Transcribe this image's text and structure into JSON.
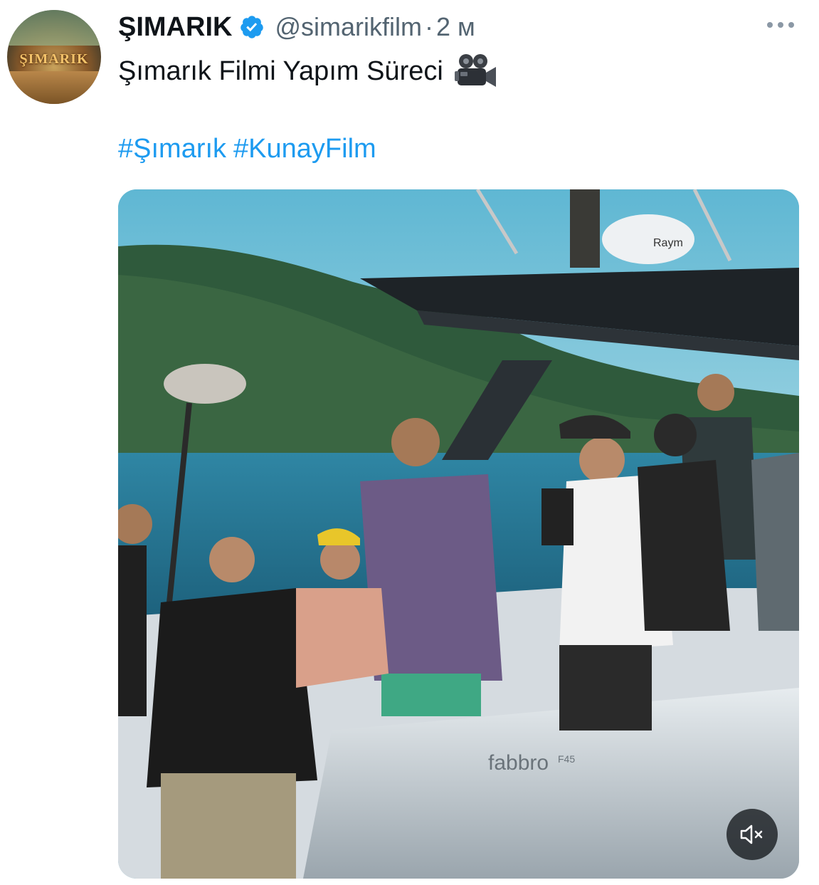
{
  "author": {
    "display_name": "ŞIMARIK",
    "handle": "@simarikfilm",
    "separator": "·",
    "timestamp": "2 м",
    "verified": true,
    "avatar_logo_text": "ŞIMARIK"
  },
  "tweet": {
    "text": "Şımarık Filmi Yapım Süreci",
    "emoji_icon": "movie-camera-icon",
    "hashtags": [
      "#Şımarık",
      "#KunayFilm"
    ]
  },
  "media": {
    "type": "video",
    "boat_brand_text": "fabbro",
    "boat_model_text": "F45",
    "radar_text": "Raym",
    "mute_icon": "speaker-muted-icon"
  },
  "colors": {
    "text_primary": "#0f1419",
    "text_secondary": "#536471",
    "link": "#1d9bf0",
    "verified_badge": "#1d9bf0"
  }
}
